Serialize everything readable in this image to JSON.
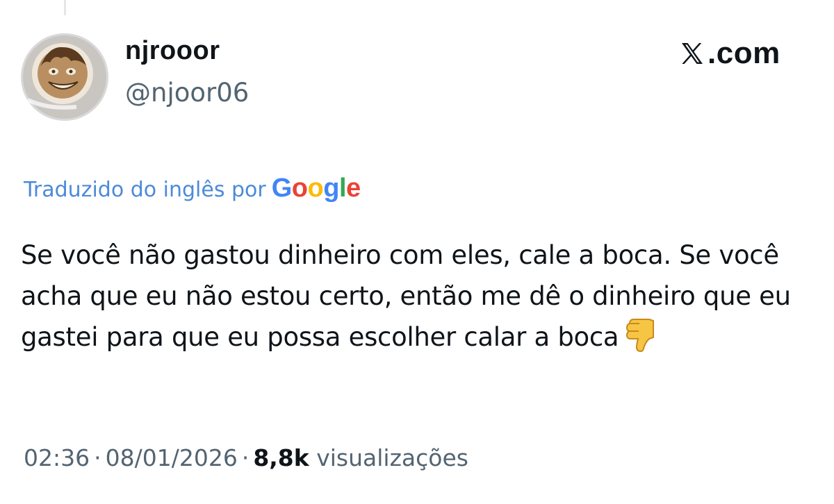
{
  "author": {
    "display_name": "njrooor",
    "handle": "@njoor06",
    "avatar_icon": "latte-art-face-avatar"
  },
  "brand": {
    "icon": "x-logo-icon",
    "text": ".com"
  },
  "translation": {
    "label": "Traduzido do inglês por",
    "provider": "Google"
  },
  "tweet": {
    "text": "Se você não gastou dinheiro com eles, cale a boca. Se você acha que eu não estou certo, então me dê o dinheiro que eu gastei para que eu possa escolher calar a boca",
    "emoji": "thumbs-down-emoji"
  },
  "meta": {
    "time": "02:36",
    "separator": "·",
    "date": "08/01/2026",
    "views_count": "8,8k",
    "views_label": "visualizações"
  },
  "colors": {
    "translation_link": "#4c8ad8",
    "secondary_text": "#536471",
    "primary_text": "#0f1419"
  }
}
